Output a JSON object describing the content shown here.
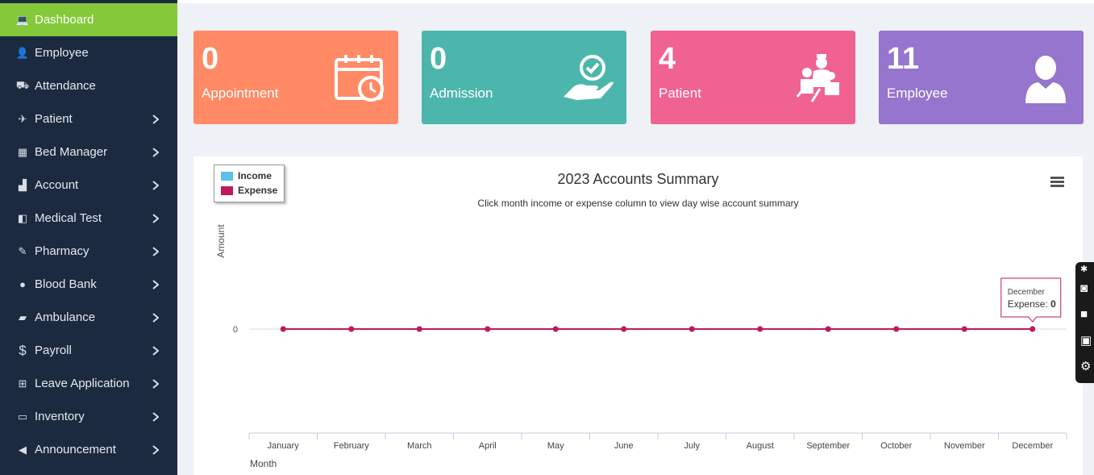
{
  "sidebar": {
    "items": [
      {
        "label": "Dashboard",
        "icon": "laptop-icon",
        "active": true,
        "has_submenu": false
      },
      {
        "label": "Employee",
        "icon": "user-icon",
        "has_submenu": false
      },
      {
        "label": "Attendance",
        "icon": "attendance-icon",
        "has_submenu": false
      },
      {
        "label": "Patient",
        "icon": "bed-patient-icon",
        "has_submenu": true
      },
      {
        "label": "Bed Manager",
        "icon": "bed-icon",
        "has_submenu": true
      },
      {
        "label": "Account",
        "icon": "bar-chart-icon",
        "has_submenu": true
      },
      {
        "label": "Medical Test",
        "icon": "lab-icon",
        "has_submenu": true
      },
      {
        "label": "Pharmacy",
        "icon": "pills-icon",
        "has_submenu": true
      },
      {
        "label": "Blood Bank",
        "icon": "blood-drop-icon",
        "has_submenu": true
      },
      {
        "label": "Ambulance",
        "icon": "ambulance-icon",
        "has_submenu": true
      },
      {
        "label": "Payroll",
        "icon": "dollar-icon",
        "has_submenu": true
      },
      {
        "label": "Leave Application",
        "icon": "calendar-grid-icon",
        "has_submenu": true
      },
      {
        "label": "Inventory",
        "icon": "keyboard-icon",
        "has_submenu": true
      },
      {
        "label": "Announcement",
        "icon": "megaphone-icon",
        "has_submenu": true
      }
    ]
  },
  "cards": [
    {
      "count": "0",
      "label": "Appointment",
      "color": "#ff8a65",
      "icon": "calendar-clock-icon"
    },
    {
      "count": "0",
      "label": "Admission",
      "color": "#4db6ac",
      "icon": "hand-heart-icon"
    },
    {
      "count": "4",
      "label": "Patient",
      "color": "#f06292",
      "icon": "patient-group-icon"
    },
    {
      "count": "11",
      "label": "Employee",
      "color": "#9575cd",
      "icon": "person-icon"
    }
  ],
  "chart_data": {
    "type": "line",
    "title": "2023 Accounts Summary",
    "subtitle": "Click month income or expense column to view day wise account summary",
    "ylabel": "Amount",
    "xlabel": "Month",
    "categories": [
      "January",
      "February",
      "March",
      "April",
      "May",
      "June",
      "July",
      "August",
      "September",
      "October",
      "November",
      "December"
    ],
    "series": [
      {
        "name": "Income",
        "color": "#5bc0eb",
        "values": [
          0,
          0,
          0,
          0,
          0,
          0,
          0,
          0,
          0,
          0,
          0,
          0
        ]
      },
      {
        "name": "Expense",
        "color": "#c2185b",
        "values": [
          0,
          0,
          0,
          0,
          0,
          0,
          0,
          0,
          0,
          0,
          0,
          0
        ]
      }
    ],
    "y_ticks": [
      "0"
    ],
    "legend_position": "top-left",
    "grid": true,
    "tooltip": {
      "month": "December",
      "series": "Expense",
      "value": "0"
    }
  }
}
